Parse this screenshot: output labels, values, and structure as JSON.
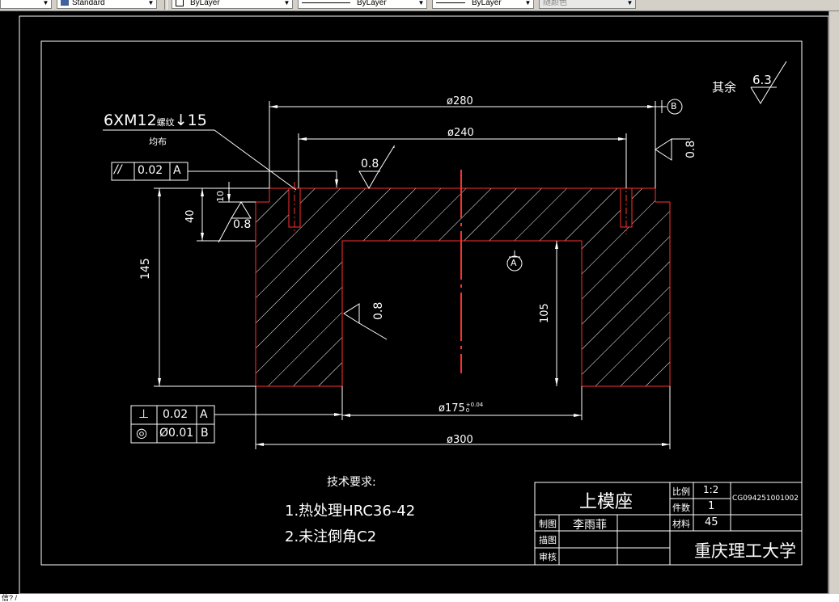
{
  "toolbar": {
    "text_style": "Standard",
    "layer": "ByLayer",
    "linetype": "ByLayer",
    "lineweight": "ByLayer",
    "color": "随颜色"
  },
  "drawing": {
    "fcf_parallel": {
      "symbol": "//",
      "value": "0.02",
      "datum": "A"
    },
    "fcf_perp": {
      "symbol": "⊥",
      "value": "0.02",
      "datum": "A"
    },
    "fcf_concentric": {
      "symbol": "◎",
      "value": "Ø0.01",
      "datum": "B"
    },
    "thread_note": "6XM12",
    "thread_note_suffix": "螺纹",
    "thread_depth": "↓15",
    "thread_note2": "均布",
    "dim_phi280": "ø280",
    "dim_phi240": "ø240",
    "dim_phi175": "ø175",
    "dim_phi175_tol_upper": "+0.04",
    "dim_phi175_tol_lower": "0",
    "dim_phi300": "ø300",
    "dim_145": "145",
    "dim_40": "40",
    "dim_10": "10",
    "dim_105": "105",
    "rough_top": "0.8",
    "rough_left": "0.8",
    "rough_right": "0.8",
    "rough_bore": "0.8",
    "rough_other_label": "其余",
    "rough_other_value": "6.3",
    "datum_b": "B",
    "datum_a": "A"
  },
  "notes": {
    "title": "技术要求:",
    "line1": "1.热处理HRC36-42",
    "line2": "2.未注倒角C2"
  },
  "title_block": {
    "part_name": "上模座",
    "scale_label": "比例",
    "scale_value": "1:2",
    "qty_label": "件数",
    "qty_value": "1",
    "material_label": "材料",
    "material_value": "45",
    "drawing_no": "CG094251001002",
    "drawn_label": "制图",
    "drawn_name": "李雨菲",
    "drafted_label": "描图",
    "reviewed_label": "审核",
    "org": "重庆理工大学"
  },
  "command_line": {
    "text": "信? /"
  }
}
